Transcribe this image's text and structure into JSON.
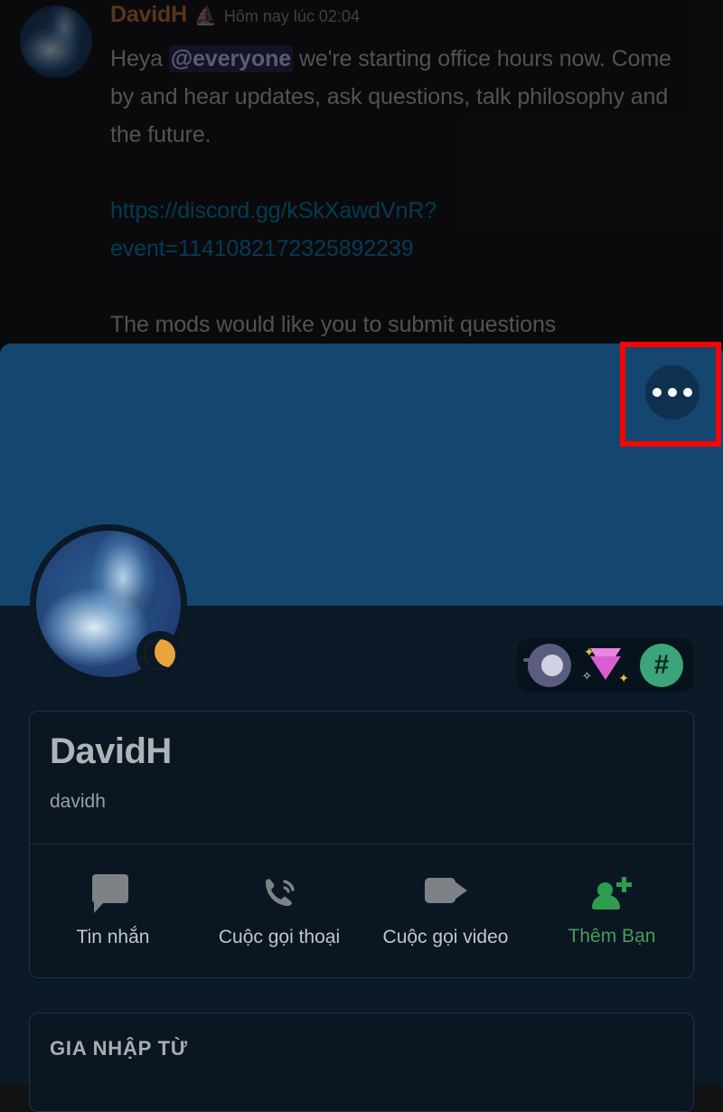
{
  "chat": {
    "author": "DavidH",
    "author_emoji": "⛵",
    "timestamp": "Hôm nay lúc 02:04",
    "line1_pre": "Heya ",
    "mention": "@everyone",
    "line1_post": " we're starting office hours now. Come by and hear updates, ask questions, talk philosophy and the future.",
    "link": "https://discord.gg/kSkXawdVnR?event=1141082172325892239",
    "line3": "The mods would like you to submit questions",
    "author_color": "#c1793a",
    "link_color": "#0c80b8",
    "mention_bg": "#282a52"
  },
  "sheet": {
    "banner_color": "#14466f",
    "body_color": "#0b1a26",
    "highlight_color": "#fe0000"
  },
  "more_options": {
    "icon": "ellipsis-horizontal-icon",
    "label": "Thêm tùy chọn"
  },
  "avatar": {
    "icon": "user-avatar",
    "status": "idle-moon-icon"
  },
  "badges": [
    {
      "name": "meteor-badge",
      "label": "Meteor"
    },
    {
      "name": "nitro-gem-badge",
      "label": "Nitro"
    },
    {
      "name": "hashtag-badge",
      "label": "Hashtag"
    }
  ],
  "profile": {
    "display_name": "DavidH",
    "username": "davidh"
  },
  "actions": [
    {
      "icon": "chat-bubble-icon",
      "label": "Tin nhắn",
      "accent": false
    },
    {
      "icon": "phone-call-icon",
      "label": "Cuộc gọi thoại",
      "accent": false
    },
    {
      "icon": "video-camera-icon",
      "label": "Cuộc gọi video",
      "accent": false
    },
    {
      "icon": "person-add-icon",
      "label": "Thêm Bạn",
      "accent": true
    }
  ],
  "joined": {
    "title": "GIA NHẬP TỪ"
  }
}
